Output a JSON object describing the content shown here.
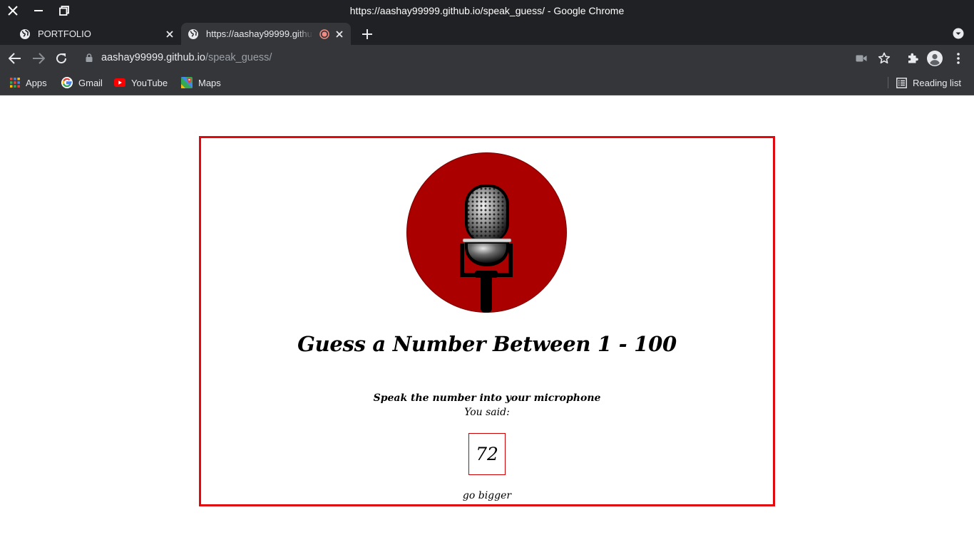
{
  "window": {
    "title": "https://aashay99999.github.io/speak_guess/ - Google Chrome"
  },
  "tabs": [
    {
      "label": "PORTFOLIO",
      "active": false,
      "icon": "globe-icon"
    },
    {
      "label": "https://aashay99999.github.io/speak_guess/",
      "active": true,
      "icon": "globe-icon",
      "recording": true
    }
  ],
  "omnibox": {
    "host": "aashay99999.github.io",
    "path": "/speak_guess/"
  },
  "bookmarks": {
    "items": [
      {
        "label": "Apps",
        "icon": "apps-grid-icon"
      },
      {
        "label": "Gmail",
        "icon": "google-icon"
      },
      {
        "label": "YouTube",
        "icon": "youtube-icon"
      },
      {
        "label": "Maps",
        "icon": "maps-icon"
      }
    ],
    "reading_list": "Reading list"
  },
  "page": {
    "headline": "Guess a Number Between 1 - 100",
    "instruction": "Speak the number into your microphone",
    "you_said": "You said:",
    "spoken_number": "72",
    "hint": "go bigger"
  },
  "colors": {
    "frame": "#202124",
    "toolbar": "#35363a",
    "card_border": "#e1080e",
    "mic_circle": "#aa0000"
  }
}
